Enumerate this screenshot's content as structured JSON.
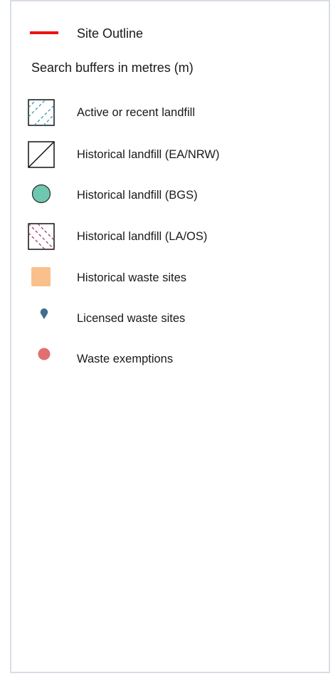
{
  "legend": {
    "site_outline": {
      "label": "Site Outline",
      "color": "#ee1111"
    },
    "buffers_note": "Search buffers in metres (m)",
    "items": [
      {
        "label": "Active or recent landfill",
        "icon": "hatched-square-blue-icon",
        "color": "#2f8fb0"
      },
      {
        "label": "Historical landfill (EA/NRW)",
        "icon": "diagonal-square-black-icon",
        "color": "#111111"
      },
      {
        "label": "Historical landfill (BGS)",
        "icon": "teal-circle-icon",
        "color": "#6fc7b2"
      },
      {
        "label": "Historical landfill (LA/OS)",
        "icon": "hatched-square-purple-icon",
        "color": "#a3286e"
      },
      {
        "label": "Historical waste sites",
        "icon": "orange-square-icon",
        "color": "#f9c08c"
      },
      {
        "label": "Licensed waste sites",
        "icon": "teardrop-pin-icon",
        "color": "#3f6f8e"
      },
      {
        "label": "Waste exemptions",
        "icon": "red-dot-icon",
        "color": "#e07070"
      }
    ]
  }
}
